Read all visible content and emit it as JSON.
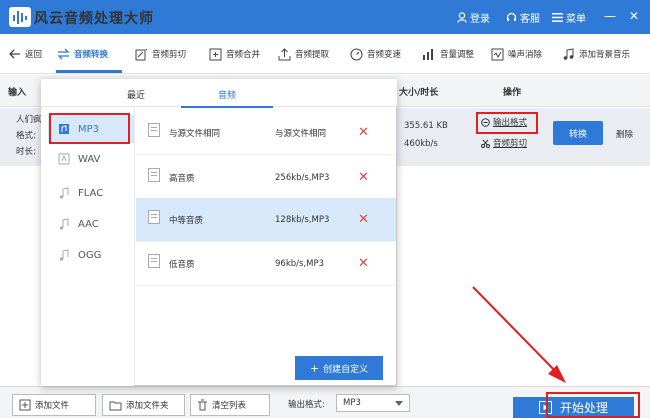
{
  "app": {
    "title": "风云音频处理大师"
  },
  "titlebar": {
    "login": "登录",
    "service": "客服",
    "menu": "菜单",
    "minimize": "—",
    "close": "✕"
  },
  "toolbar": {
    "back": "返回",
    "items": [
      "音频转换",
      "音频剪切",
      "音频合并",
      "音频提取",
      "音频变速",
      "音量调整",
      "噪声消除",
      "添加背景音乐"
    ]
  },
  "list_header": {
    "input": "输入",
    "size_duration": "大小/时长",
    "action": "操作"
  },
  "file_row": {
    "name_prefix": "人们疯",
    "format_prefix": "格式:",
    "duration_prefix": "时长:",
    "size": "355.61 KB",
    "bitrate": "460kb/s",
    "output_format": "输出格式",
    "audio_cut": "音频剪切",
    "convert": "转换",
    "delete": "删除"
  },
  "popup": {
    "tabs": [
      "最近",
      "音频"
    ],
    "active_tab": 1,
    "formats": [
      "MP3",
      "WAV",
      "FLAC",
      "AAC",
      "OGG"
    ],
    "selected_format": 0,
    "qualities": [
      {
        "name": "与源文件相同",
        "rate": "与源文件相同"
      },
      {
        "name": "高音质",
        "rate": "256kb/s,MP3"
      },
      {
        "name": "中等音质",
        "rate": "128kb/s,MP3"
      },
      {
        "name": "低音质",
        "rate": "96kb/s,MP3"
      }
    ],
    "selected_quality": 2,
    "custom_button": "创建自定义"
  },
  "bottom_bar": {
    "add_file": "添加文件",
    "add_folder": "添加文件夹",
    "clear_list": "清空列表",
    "output_format_label": "输出格式:",
    "output_format_value": "MP3",
    "start": "开始处理"
  },
  "colors": {
    "accent": "#2e7ad6",
    "highlight": "#e02020",
    "selection": "#d6e8fa"
  }
}
